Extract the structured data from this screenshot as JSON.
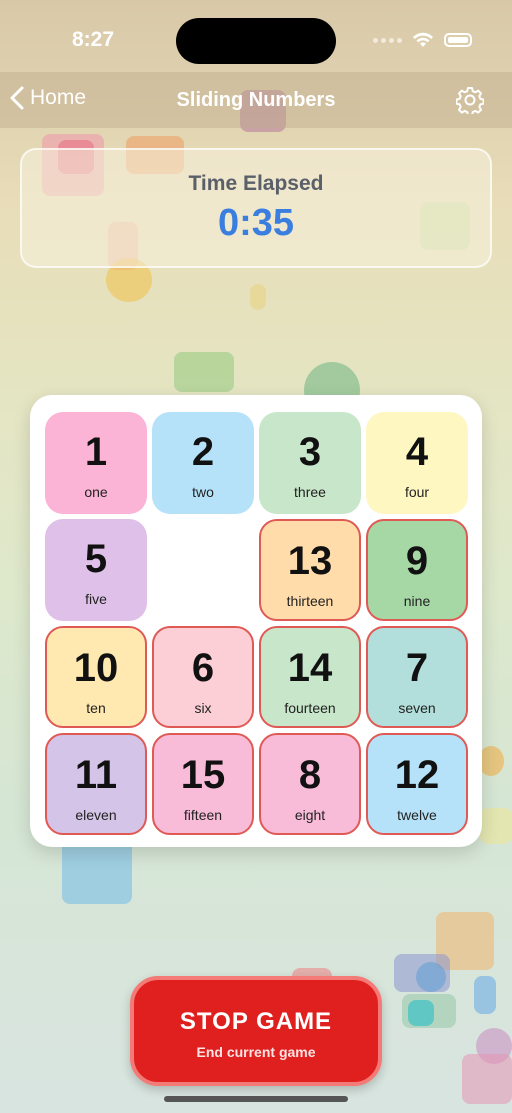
{
  "status_bar": {
    "time": "8:27"
  },
  "nav": {
    "back_label": "Home",
    "title": "Sliding Numbers"
  },
  "timer": {
    "label": "Time Elapsed",
    "value": "0:35"
  },
  "board": {
    "tiles": [
      {
        "number": "1",
        "word": "one",
        "color": "#fbb3d6",
        "misplaced": false
      },
      {
        "number": "2",
        "word": "two",
        "color": "#b6e2f9",
        "misplaced": false
      },
      {
        "number": "3",
        "word": "three",
        "color": "#c8e6c9",
        "misplaced": false
      },
      {
        "number": "4",
        "word": "four",
        "color": "#fff7c2",
        "misplaced": false
      },
      {
        "number": "5",
        "word": "five",
        "color": "#dfc0e8",
        "misplaced": false
      },
      null,
      {
        "number": "13",
        "word": "thirteen",
        "color": "#ffdcaa",
        "misplaced": true
      },
      {
        "number": "9",
        "word": "nine",
        "color": "#a6d8a6",
        "misplaced": true
      },
      {
        "number": "10",
        "word": "ten",
        "color": "#ffe9b0",
        "misplaced": true
      },
      {
        "number": "6",
        "word": "six",
        "color": "#fccfd6",
        "misplaced": true
      },
      {
        "number": "14",
        "word": "fourteen",
        "color": "#c8e6c9",
        "misplaced": true
      },
      {
        "number": "7",
        "word": "seven",
        "color": "#b2dfdb",
        "misplaced": true
      },
      {
        "number": "11",
        "word": "eleven",
        "color": "#d3c4e8",
        "misplaced": true
      },
      {
        "number": "15",
        "word": "fifteen",
        "color": "#f8bcd8",
        "misplaced": true
      },
      {
        "number": "8",
        "word": "eight",
        "color": "#f8bcd8",
        "misplaced": true
      },
      {
        "number": "12",
        "word": "twelve",
        "color": "#b6e2f9",
        "misplaced": true
      }
    ]
  },
  "stop_button": {
    "title": "STOP GAME",
    "subtitle": "End current game"
  },
  "colors": {
    "accent_blue": "#3a7ee0",
    "stop_red": "#e0201f",
    "misplaced_border": "#e05a55"
  }
}
